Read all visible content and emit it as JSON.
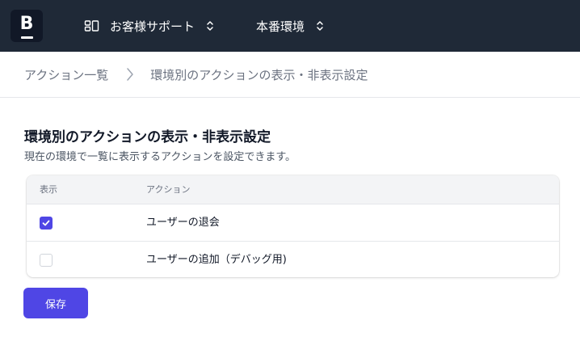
{
  "app": {
    "logo_letter": "B",
    "org_selector": {
      "label": "お客様サポート",
      "icon": "organization-icon"
    },
    "env_selector": {
      "label": "本番環境"
    }
  },
  "breadcrumb": {
    "items": [
      {
        "label": "アクション一覧"
      },
      {
        "label": "環境別のアクションの表示・非表示設定"
      }
    ]
  },
  "main": {
    "title": "環境別のアクションの表示・非表示設定",
    "description": "現在の環境で一覧に表示するアクションを設定できます。",
    "table": {
      "columns": [
        "表示",
        "アクション"
      ],
      "rows": [
        {
          "visible": true,
          "action": "ユーザーの退会"
        },
        {
          "visible": false,
          "action": "ユーザーの追加（デバッグ用)"
        }
      ]
    },
    "save_label": "保存"
  },
  "colors": {
    "topbar": "#1f2937",
    "accent": "#4f46e5",
    "text": "#111827",
    "muted": "#6b7280"
  }
}
